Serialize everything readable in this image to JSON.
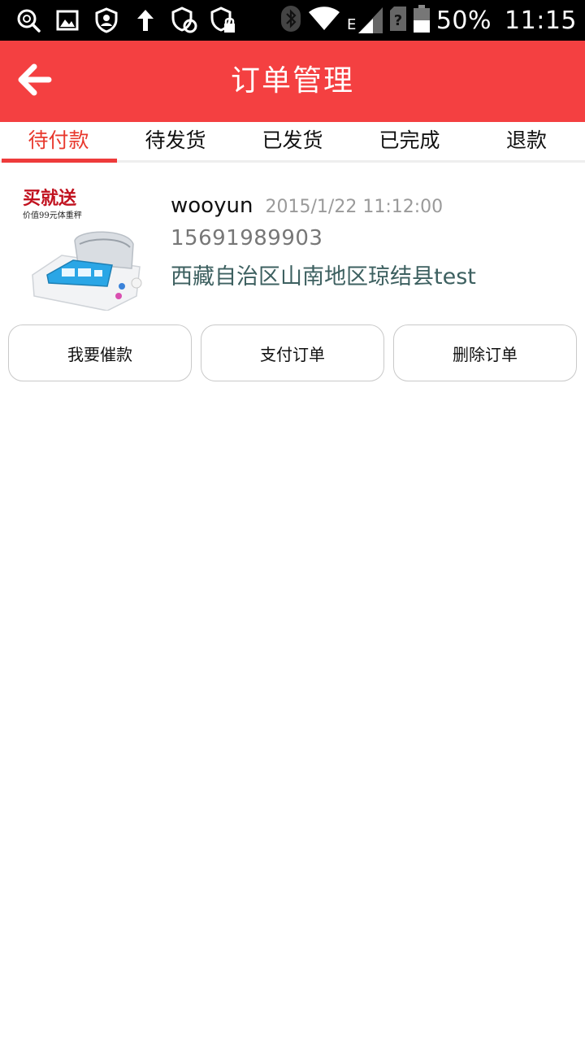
{
  "status_bar": {
    "battery": "50%",
    "time": "11:15",
    "network": "E",
    "icons": [
      "search-icon",
      "image-icon",
      "account-shield-icon",
      "upload-icon",
      "shield-sync-icon",
      "shield-lock-icon",
      "bluetooth-icon",
      "wifi-icon",
      "signal-icon",
      "sim-unknown-icon",
      "battery-icon"
    ]
  },
  "header": {
    "title": "订单管理",
    "back_icon": "back-arrow-icon",
    "color": "#f44041"
  },
  "tabs": [
    {
      "label": "待付款",
      "active": true
    },
    {
      "label": "待发货",
      "active": false
    },
    {
      "label": "已发货",
      "active": false
    },
    {
      "label": "已完成",
      "active": false
    },
    {
      "label": "退款",
      "active": false
    }
  ],
  "order": {
    "image": {
      "promo_title": "买就送",
      "promo_subtitle": "价值99元体重秤"
    },
    "username": "wooyun",
    "time": "2015/1/22 11:12:00",
    "phone": "15691989903",
    "address": "西藏自治区山南地区琼结县test",
    "actions": [
      {
        "label": "我要催款"
      },
      {
        "label": "支付订单"
      },
      {
        "label": "删除订单"
      }
    ]
  },
  "colors": {
    "accent": "#f44041",
    "active_tab": "#e8392e",
    "address": "#3d6060"
  }
}
